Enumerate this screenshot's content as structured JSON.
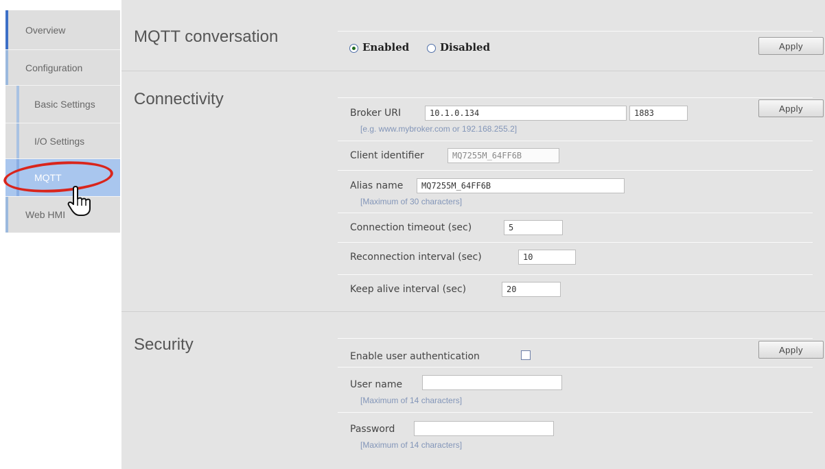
{
  "nav": {
    "overview": "Overview",
    "configuration": "Configuration",
    "basic_settings": "Basic Settings",
    "io_settings": "I/O Settings",
    "mqtt": "MQTT",
    "web_hmi": "Web HMI"
  },
  "mqtt_conversation": {
    "title": "MQTT conversation",
    "enabled_label": "Enabled",
    "disabled_label": "Disabled",
    "selected": "Enabled",
    "apply": "Apply"
  },
  "connectivity": {
    "title": "Connectivity",
    "apply": "Apply",
    "broker_uri_label": "Broker URI",
    "broker_uri_value": "10.1.0.134",
    "broker_port_value": "1883",
    "broker_hint": "[e.g. www.mybroker.com or 192.168.255.2]",
    "client_id_label": "Client identifier",
    "client_id_value": "MQ7255M_64FF6B",
    "alias_label": "Alias name",
    "alias_value": "MQ7255M_64FF6B",
    "alias_hint": "[Maximum of 30 characters]",
    "timeout_label": "Connection timeout (sec)",
    "timeout_value": "5",
    "reconnect_label": "Reconnection interval (sec)",
    "reconnect_value": "10",
    "keepalive_label": "Keep alive interval (sec)",
    "keepalive_value": "20"
  },
  "security": {
    "title": "Security",
    "apply": "Apply",
    "auth_label": "Enable user authentication",
    "auth_checked": false,
    "username_label": "User name",
    "username_value": "",
    "username_hint": "[Maximum of 14 characters]",
    "password_label": "Password",
    "password_value": "",
    "password_hint": "[Maximum of 14 characters]"
  },
  "colors": {
    "main_bg": "#e4e4e4",
    "nav_bg": "#dedede",
    "nav_active_bg": "#a9c6ee",
    "accent": "#3c6fc7",
    "highlight_ring": "#d9251c",
    "hint_text": "#8295b8"
  },
  "icons": {
    "cursor": "hand-pointer-icon",
    "annotation": "red-circle-highlight"
  }
}
